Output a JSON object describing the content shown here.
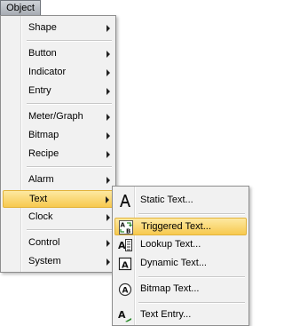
{
  "menubar": {
    "title": "Object"
  },
  "menu": {
    "items": [
      {
        "label": "Shape",
        "submenu": true
      },
      {
        "label": "Button",
        "submenu": true
      },
      {
        "label": "Indicator",
        "submenu": true
      },
      {
        "label": "Entry",
        "submenu": true
      },
      {
        "label": "Meter/Graph",
        "submenu": true
      },
      {
        "label": "Bitmap",
        "submenu": true
      },
      {
        "label": "Recipe",
        "submenu": true
      },
      {
        "label": "Alarm",
        "submenu": true
      },
      {
        "label": "Text",
        "submenu": true,
        "highlighted": true
      },
      {
        "label": "Clock",
        "submenu": true
      },
      {
        "label": "Control",
        "submenu": true
      },
      {
        "label": "System",
        "submenu": true
      }
    ]
  },
  "submenu": {
    "items": [
      {
        "label": "Static Text...",
        "icon": "static-text-icon"
      },
      {
        "label": "Triggered Text...",
        "icon": "triggered-text-icon",
        "highlighted": true
      },
      {
        "label": "Lookup Text...",
        "icon": "lookup-text-icon"
      },
      {
        "label": "Dynamic Text...",
        "icon": "dynamic-text-icon"
      },
      {
        "label": "Bitmap Text...",
        "icon": "bitmap-text-icon"
      },
      {
        "label": "Text Entry...",
        "icon": "text-entry-icon"
      }
    ]
  },
  "colors": {
    "highlight_top": "#fde9a2",
    "highlight_bottom": "#f7c94f",
    "menu_bg": "#f1f1f1"
  }
}
